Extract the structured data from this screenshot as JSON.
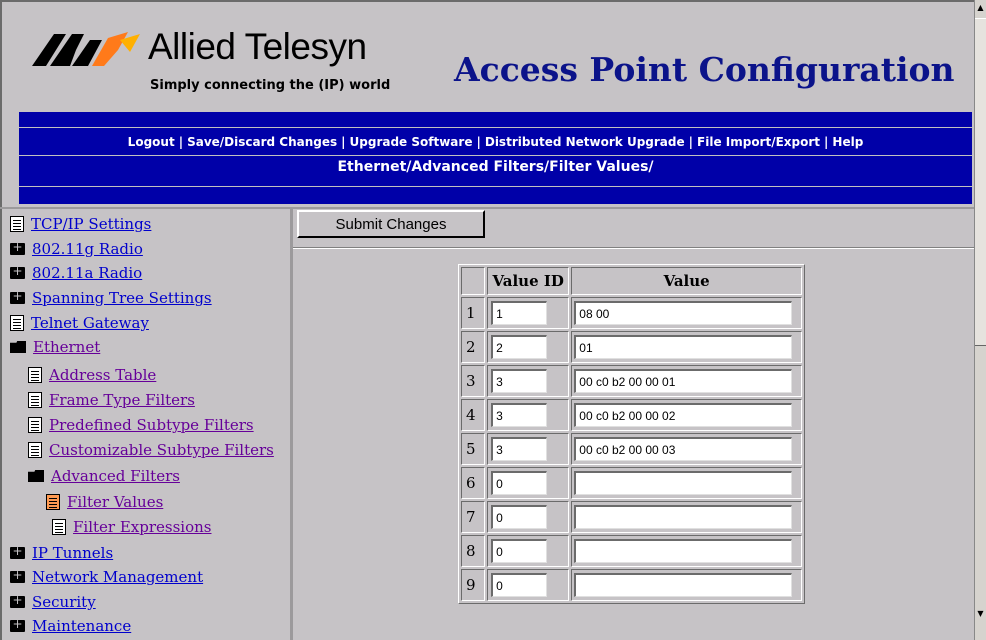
{
  "header": {
    "logo_word": "Allied Telesyn",
    "logo_tagline": "Simply connecting the (IP) world",
    "title": "Access Point Configuration"
  },
  "nav": {
    "links": [
      "Logout",
      "Save/Discard Changes",
      "Upgrade Software",
      "Distributed Network Upgrade",
      "File Import/Export",
      "Help"
    ],
    "breadcrumb": "Ethernet/Advanced Filters/Filter Values/"
  },
  "sidebar": {
    "items": [
      {
        "label": "TCP/IP Settings",
        "icon": "document-icon"
      },
      {
        "label": "802.11g Radio",
        "icon": "folder-closed-icon"
      },
      {
        "label": "802.11a Radio",
        "icon": "folder-closed-icon"
      },
      {
        "label": "Spanning Tree Settings",
        "icon": "folder-closed-icon"
      },
      {
        "label": "Telnet Gateway",
        "icon": "document-icon"
      },
      {
        "label": "Ethernet",
        "icon": "folder-open-icon"
      },
      {
        "label": "Address Table",
        "icon": "document-icon"
      },
      {
        "label": "Frame Type Filters",
        "icon": "document-icon"
      },
      {
        "label": "Predefined Subtype Filters",
        "icon": "document-icon"
      },
      {
        "label": "Customizable Subtype Filters",
        "icon": "document-icon"
      },
      {
        "label": "Advanced Filters",
        "icon": "folder-open-icon"
      },
      {
        "label": "Filter Values",
        "icon": "document-active-icon"
      },
      {
        "label": "Filter Expressions",
        "icon": "document-icon"
      },
      {
        "label": "IP Tunnels",
        "icon": "folder-closed-icon"
      },
      {
        "label": "Network Management",
        "icon": "folder-closed-icon"
      },
      {
        "label": "Security",
        "icon": "folder-closed-icon"
      },
      {
        "label": "Maintenance",
        "icon": "folder-closed-icon"
      }
    ]
  },
  "main": {
    "submit_label": "Submit Changes",
    "table": {
      "headers": [
        "Value ID",
        "Value"
      ],
      "rows": [
        {
          "num": "1",
          "id": "1",
          "value": "08 00"
        },
        {
          "num": "2",
          "id": "2",
          "value": "01"
        },
        {
          "num": "3",
          "id": "3",
          "value": "00 c0 b2 00 00 01"
        },
        {
          "num": "4",
          "id": "3",
          "value": "00 c0 b2 00 00 02"
        },
        {
          "num": "5",
          "id": "3",
          "value": "00 c0 b2 00 00 03"
        },
        {
          "num": "6",
          "id": "0",
          "value": ""
        },
        {
          "num": "7",
          "id": "0",
          "value": ""
        },
        {
          "num": "8",
          "id": "0",
          "value": ""
        },
        {
          "num": "9",
          "id": "0",
          "value": ""
        }
      ]
    }
  },
  "colors": {
    "nav_band": "#0000a8",
    "title_text": "#0b138a",
    "frame_bg": "#c6c3c6",
    "link": "#0000cc",
    "visited_link": "#660099",
    "active_doc_icon": "#ff9a52"
  }
}
